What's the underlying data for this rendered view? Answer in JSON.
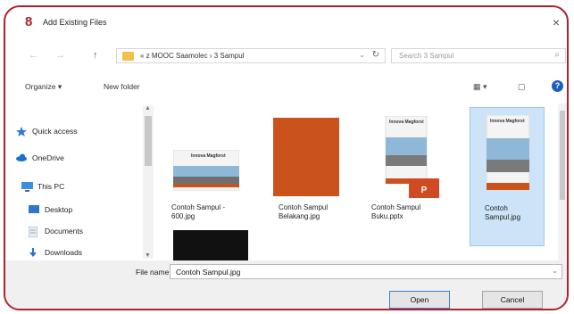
{
  "window": {
    "title": "Add Existing Files",
    "logo_glyph": "8",
    "close_glyph": "×"
  },
  "address": {
    "back_glyph": "←",
    "forward_glyph": "→",
    "up_glyph": "↑",
    "path": "« z MOOC Saamolec  ›  3 Sampul",
    "dropdown_glyph": "⌄",
    "refresh_glyph": "↻",
    "search_placeholder": "Search 3 Sampul",
    "search_glyph": "⌕"
  },
  "toolbar": {
    "organize": "Organize ▾",
    "new_folder": "New folder",
    "view_glyph": "▦ ▾",
    "pane_glyph": "▢",
    "help_glyph": "?"
  },
  "nav": {
    "items": [
      {
        "label": "Quick access",
        "icon": "star-icon",
        "color": "#2b7bd6"
      },
      {
        "label": "OneDrive",
        "icon": "cloud-icon",
        "color": "#1a6fd1"
      },
      {
        "label": "This PC",
        "icon": "computer-icon",
        "color": "#3a8fe0"
      },
      {
        "label": "Desktop",
        "icon": "desktop-icon",
        "color": "#2f78c8"
      },
      {
        "label": "Documents",
        "icon": "documents-icon",
        "color": "#9aa7b6"
      },
      {
        "label": "Downloads",
        "icon": "download-icon",
        "color": "#2b70c9"
      }
    ]
  },
  "files": [
    {
      "label": "Contoh Sampul - 600.jpg",
      "selected": false,
      "thumb_title": "Innova Magforst"
    },
    {
      "label": "Contoh Sampul Belakang.jpg",
      "selected": false,
      "thumb_title": ""
    },
    {
      "label": "Contoh Sampul Buku.pptx",
      "selected": false,
      "thumb_title": "Innova Magforst"
    },
    {
      "label": "Contoh Sampul.jpg",
      "selected": true,
      "thumb_title": "Innova Magforst"
    }
  ],
  "footer": {
    "filename_label": "File name:",
    "filename_value": "Contoh Sampul.jpg",
    "filename_dropdown_glyph": "⌄",
    "open_label": "Open",
    "cancel_label": "Cancel"
  },
  "colors": {
    "accent_red": "#b3202a",
    "selection": "#cde3f7",
    "cover_orange": "#c9521d"
  }
}
